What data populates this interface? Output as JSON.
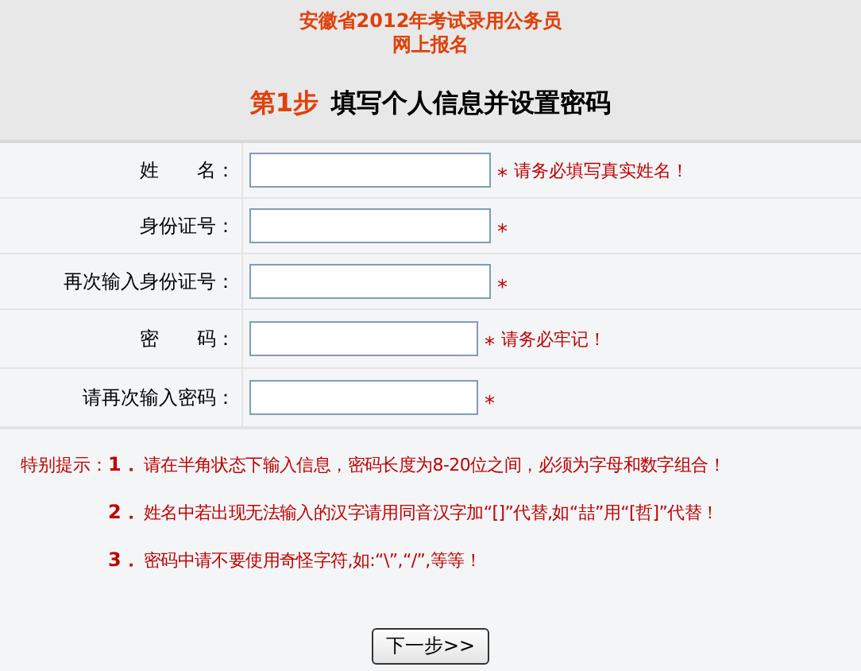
{
  "header": {
    "title_lines": [
      "安徽省2012年考试录用公务员",
      "网上报名"
    ]
  },
  "step": {
    "number": "第1步",
    "title": "填写个人信息并设置密码"
  },
  "fields": [
    {
      "label": "姓　　名：",
      "required": "*",
      "hint": "请务必填写真实姓名！"
    },
    {
      "label": "身份证号：",
      "required": "*"
    },
    {
      "label": "再次输入身份证号：",
      "required": "*"
    },
    {
      "label": "密　　码：",
      "required": "*",
      "hint": "请务必牢记！"
    },
    {
      "label": "请再次输入密码：",
      "required": "*"
    }
  ],
  "notes": {
    "label": "特别提示：",
    "items": [
      {
        "number": "1．",
        "text": "请在半角状态下输入信息，密码长度为8-20位之间，必须为字母和数字组合！"
      },
      {
        "number": "2．",
        "text": "姓名中若出现无法输入的汉字请用同音汉字加“[]”代替,如“喆”用“[哲]”代替！"
      },
      {
        "number": "3．",
        "text": "密码中请不要使用奇怪字符,如:“\\”,“/”,等等！"
      }
    ]
  },
  "next_button": "下一步>>"
}
